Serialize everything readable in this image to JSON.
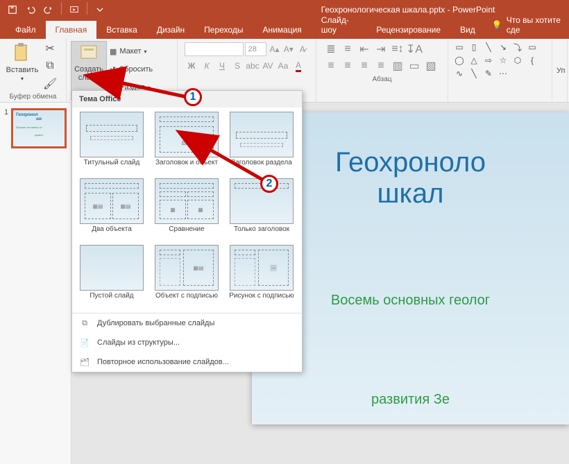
{
  "app": {
    "title": "Геохронологическая шкала.pptx - PowerPoint"
  },
  "qat": {
    "save": "save-icon",
    "undo": "undo-icon",
    "redo": "redo-icon",
    "start": "start-from-beginning-icon",
    "touch": "touch-mode-icon"
  },
  "tabs": {
    "file": "Файл",
    "home": "Главная",
    "insert": "Вставка",
    "design": "Дизайн",
    "transitions": "Переходы",
    "animations": "Анимация",
    "slideshow": "Слайд-шоу",
    "review": "Рецензирование",
    "view": "Вид",
    "tell_me": "Что вы хотите сде"
  },
  "ribbon": {
    "paste": "Вставить",
    "clipboard_label": "Буфер обмена",
    "new_slide": "Создать слайд",
    "layout": "Макет",
    "reset": "Сбросить",
    "section": "Раздел",
    "font_size_placeholder": "28",
    "paragraph_label": "Абзац",
    "edit_label": "Уп"
  },
  "layout_panel": {
    "header": "Тема Office",
    "items": [
      "Титульный слайд",
      "Заголовок и объект",
      "Заголовок раздела",
      "Два объекта",
      "Сравнение",
      "Только заголовок",
      "Пустой слайд",
      "Объект с подписью",
      "Рисунок с подписью"
    ],
    "menu": {
      "duplicate": "Дублировать выбранные слайды",
      "outline": "Слайды из структуры...",
      "reuse": "Повторное использование слайдов..."
    }
  },
  "thumb": {
    "number": "1",
    "title": "Геохронол",
    "title2": "шк",
    "sub": "Восемь основных ге",
    "sub2": "развит"
  },
  "slide": {
    "title1": "Геохроноло",
    "title2": "шкал",
    "sub1": "Восемь основных геолог",
    "sub2": "развития Зе"
  },
  "annotations": {
    "n1": "1",
    "n2": "2"
  }
}
